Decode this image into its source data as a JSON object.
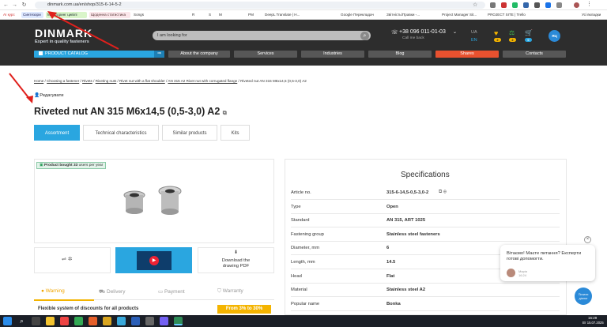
{
  "browser": {
    "url": "dinmark.com.ua/en/shop/315-6-14-5-2",
    "bookmarks": [
      {
        "label": "AI курс",
        "bg": "#fff",
        "fg": "#d03030"
      },
      {
        "label": "Cинтезори",
        "bg": "#dde8ff",
        "fg": "#225"
      },
      {
        "label": "Моніторинг цивілі",
        "bg": "#d9f5c9",
        "fg": "#233"
      },
      {
        "label": "Щоденна статистика",
        "bg": "#fbe6ea",
        "fg": "#533"
      },
      {
        "label": "Songs",
        "bg": "#fff",
        "fg": "#333"
      },
      {
        "label": "R",
        "bg": "#fff",
        "fg": "#333"
      },
      {
        "label": "S",
        "bg": "#fff",
        "fg": "#333"
      },
      {
        "label": "M",
        "bg": "#fff",
        "fg": "#333"
      },
      {
        "label": "PM",
        "bg": "#fff",
        "fg": "#333"
      },
      {
        "label": "DeepL Translate | Н...",
        "bg": "#fff",
        "fg": "#333"
      },
      {
        "label": "Google Перекладач",
        "bg": "#fff",
        "fg": "#333"
      },
      {
        "label": "Звітність/Правки -...",
        "bg": "#fff",
        "fg": "#333"
      },
      {
        "label": "Project Manager Sit...",
        "bg": "#fff",
        "fg": "#333"
      },
      {
        "label": "PROJECT SITE | Trello",
        "bg": "#fff",
        "fg": "#333"
      },
      {
        "label": "Усі вкладки",
        "bg": "#fff",
        "fg": "#333"
      }
    ]
  },
  "header": {
    "logo": "DINMARK",
    "tagline": "Expert in quality fasteners",
    "search_placeholder": "I am looking for",
    "phone": "+38 096 011-01-03",
    "callback": "Call me back",
    "lang_ua": "UA",
    "lang_en": "EN",
    "badges": [
      "2",
      "2",
      "0"
    ],
    "avatar": "ЯЦ"
  },
  "menu": {
    "catalog": "PRODUCT CATALOG",
    "items": [
      "About the company",
      "Services",
      "Industries",
      "Blog",
      "Shares",
      "Contacts"
    ]
  },
  "breadcrumb": [
    "Home",
    "Choosing a fastener",
    "Rivets",
    "Riveting nuts",
    "Rivet nut with a flat shoulder",
    "AN 315 A2 Rivet nut with corrugated flange",
    "Riveted nut AN 315 M6x14,5 (0,5-3,0) A2"
  ],
  "edit_label": "Редагувати",
  "product_title": "Riveted nut AN 315 M6x14,5 (0,5-3,0) A2",
  "tabs": [
    "Assortment",
    "Technical characteristics",
    "Similar products",
    "Kits"
  ],
  "bought": {
    "prefix": "Product bought",
    "count": "33",
    "suffix": "users per year"
  },
  "download": {
    "line1": "Download the",
    "line2": "drawing PDF"
  },
  "bottom_tabs": [
    "Warning",
    "Delivery",
    "Payment",
    "Warranty"
  ],
  "discount": {
    "text": "Flexible system of discounts for all products",
    "badge": "From 3% to 30%"
  },
  "specifications": {
    "title": "Specifications",
    "rows": [
      {
        "label": "Article no.",
        "value": "315-6-14,5-0,5-3,0-2"
      },
      {
        "label": "Type",
        "value": "Open"
      },
      {
        "label": "Standard",
        "value": "AN 315, ART 1025"
      },
      {
        "label": "Fastening group",
        "value": "Stainless steel fasteners"
      },
      {
        "label": "Diameter, mm",
        "value": "6"
      },
      {
        "label": "Length, mm",
        "value": "14.5"
      },
      {
        "label": "Head",
        "value": "Flat"
      },
      {
        "label": "Material",
        "value": "Stainless steel A2"
      },
      {
        "label": "Popular name",
        "value": "Bonka"
      }
    ]
  },
  "chat": {
    "message": "Вітаємо! Маєте питання? Експерти готові допомогти.",
    "agent": "Марія",
    "time": "16:24",
    "button": "Почати діалог"
  },
  "taskbar": {
    "time": "16:29",
    "date": "Вт 15.07.2025"
  },
  "colors": {
    "accent": "#2aa6e0",
    "shares": "#e8512f",
    "header": "#2d2d2d"
  }
}
